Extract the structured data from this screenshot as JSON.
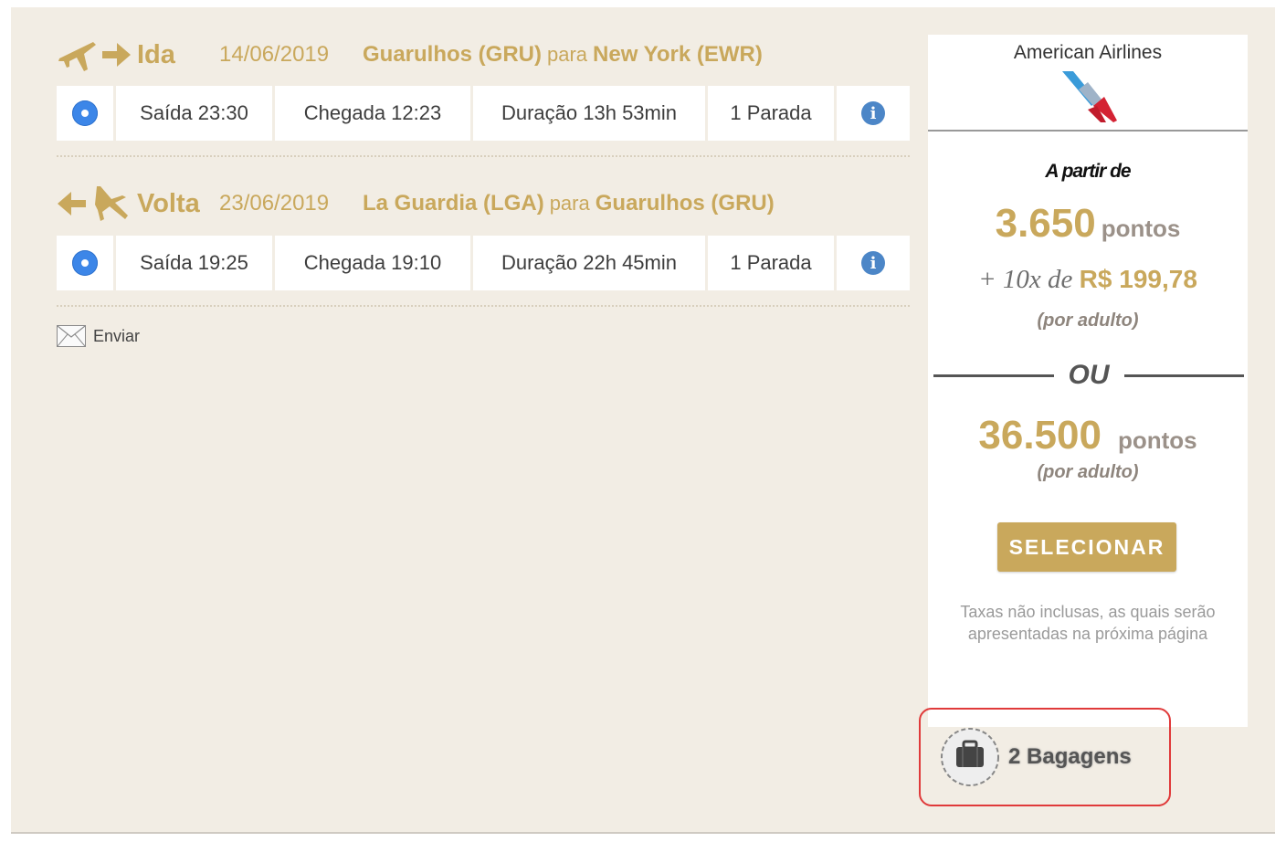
{
  "outbound": {
    "label": "Ida",
    "date": "14/06/2019",
    "origin": "Guarulhos (GRU)",
    "connector": "para",
    "destination": "New York (EWR)",
    "departure": "Saída 23:30",
    "arrival": "Chegada 12:23",
    "duration": "Duração 13h 53min",
    "stops": "1 Parada"
  },
  "return": {
    "label": "Volta",
    "date": "23/06/2019",
    "origin": "La Guardia (LGA)",
    "connector": "para",
    "destination": "Guarulhos (GRU)",
    "departure": "Saída 19:25",
    "arrival": "Chegada 19:10",
    "duration": "Duração 22h 45min",
    "stops": "1 Parada"
  },
  "send_label": "Enviar",
  "offer": {
    "airline": "American Airlines",
    "from_label": "A partir de",
    "points_a": "3.650",
    "points_word": "pontos",
    "plus_installments": "+ 10x de",
    "installment_amount": "R$ 199,78",
    "per_adult": "(por adulto)",
    "or_label": "OU",
    "points_b": "36.500",
    "select_label": "SELECIONAR",
    "taxes_line1": "Taxas não inclusas, as quais serão",
    "taxes_line2": "apresentadas na próxima página"
  },
  "baggage_label": "2 Bagagens",
  "colors": {
    "accent": "#c9a85c",
    "panel": "#f2ede4",
    "radio": "#3c86e8",
    "highlight": "#e03a3a"
  },
  "icons": {
    "outbound": [
      "plane-icon",
      "arrow-right-icon"
    ],
    "return": [
      "arrow-left-icon",
      "plane-icon"
    ],
    "info": "info-icon",
    "send": "envelope-icon",
    "baggage": "suitcase-icon"
  }
}
